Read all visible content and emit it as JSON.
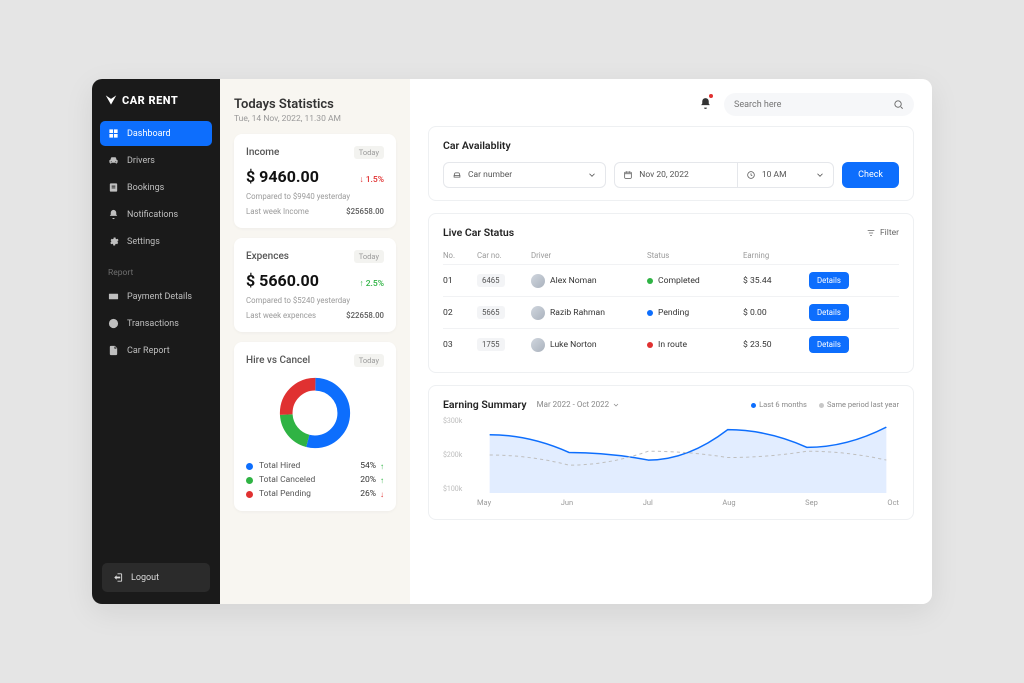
{
  "brand": "CAR RENT",
  "sidebar": {
    "items": [
      {
        "label": "Dashboard"
      },
      {
        "label": "Drivers"
      },
      {
        "label": "Bookings"
      },
      {
        "label": "Notifications"
      },
      {
        "label": "Settings"
      }
    ],
    "report_label": "Report",
    "report_items": [
      {
        "label": "Payment Details"
      },
      {
        "label": "Transactions"
      },
      {
        "label": "Car Report"
      }
    ],
    "logout": "Logout"
  },
  "stats": {
    "title": "Todays Statistics",
    "subtitle": "Tue, 14 Nov, 2022, 11.30 AM",
    "income": {
      "title": "Income",
      "tag": "Today",
      "amount": "$ 9460.00",
      "delta": "1.5%",
      "compare": "Compared to $9940 yesterday",
      "lw_label": "Last week Income",
      "lw_value": "$25658.00"
    },
    "expenses": {
      "title": "Expences",
      "tag": "Today",
      "amount": "$ 5660.00",
      "delta": "2.5%",
      "compare": "Compared to $5240 yesterday",
      "lw_label": "Last week expences",
      "lw_value": "$22658.00"
    },
    "hire": {
      "title": "Hire vs Cancel",
      "tag": "Today",
      "legend": [
        {
          "label": "Total Hired",
          "pct": "54%",
          "color": "#0d6efd",
          "dir": "up"
        },
        {
          "label": "Total Canceled",
          "pct": "20%",
          "color": "#2fb344",
          "dir": "up"
        },
        {
          "label": "Total Pending",
          "pct": "26%",
          "color": "#e03131",
          "dir": "down"
        }
      ]
    }
  },
  "search_placeholder": "Search here",
  "availability": {
    "title": "Car Availablity",
    "car_sel": "Car number",
    "date_sel": "Nov 20, 2022",
    "time_sel": "10 AM",
    "check": "Check"
  },
  "live": {
    "title": "Live Car Status",
    "filter": "Filter",
    "columns": {
      "no": "No.",
      "car": "Car no.",
      "driver": "Driver",
      "status": "Status",
      "earning": "Earning"
    },
    "details": "Details",
    "rows": [
      {
        "no": "01",
        "car": "6465",
        "driver": "Alex Noman",
        "status": "Completed",
        "scolor": "#2fb344",
        "earning": "$ 35.44"
      },
      {
        "no": "02",
        "car": "5665",
        "driver": "Razib Rahman",
        "status": "Pending",
        "scolor": "#0d6efd",
        "earning": "$ 0.00"
      },
      {
        "no": "03",
        "car": "1755",
        "driver": "Luke Norton",
        "status": "In route",
        "scolor": "#e03131",
        "earning": "$ 23.50"
      }
    ]
  },
  "summary": {
    "title": "Earning Summary",
    "range": "Mar 2022 - Oct 2022",
    "series_a": "Last 6 months",
    "series_b": "Same period last year",
    "ylabels": [
      "$300k",
      "$200k",
      "$100k"
    ],
    "xlabels": [
      "May",
      "Jun",
      "Jul",
      "Aug",
      "Sep",
      "Oct"
    ]
  },
  "chart_data": {
    "type": "line",
    "title": "Earning Summary",
    "xlabel": "",
    "ylabel": "",
    "ylim": [
      0,
      300
    ],
    "categories": [
      "May",
      "Jun",
      "Jul",
      "Aug",
      "Sep",
      "Oct"
    ],
    "series": [
      {
        "name": "Last 6 months",
        "values": [
          230,
          160,
          130,
          250,
          180,
          260
        ]
      },
      {
        "name": "Same period last year",
        "values": [
          150,
          110,
          165,
          140,
          165,
          130
        ]
      }
    ]
  },
  "colors": {
    "primary": "#0d6efd",
    "green": "#2fb344",
    "red": "#e03131"
  }
}
